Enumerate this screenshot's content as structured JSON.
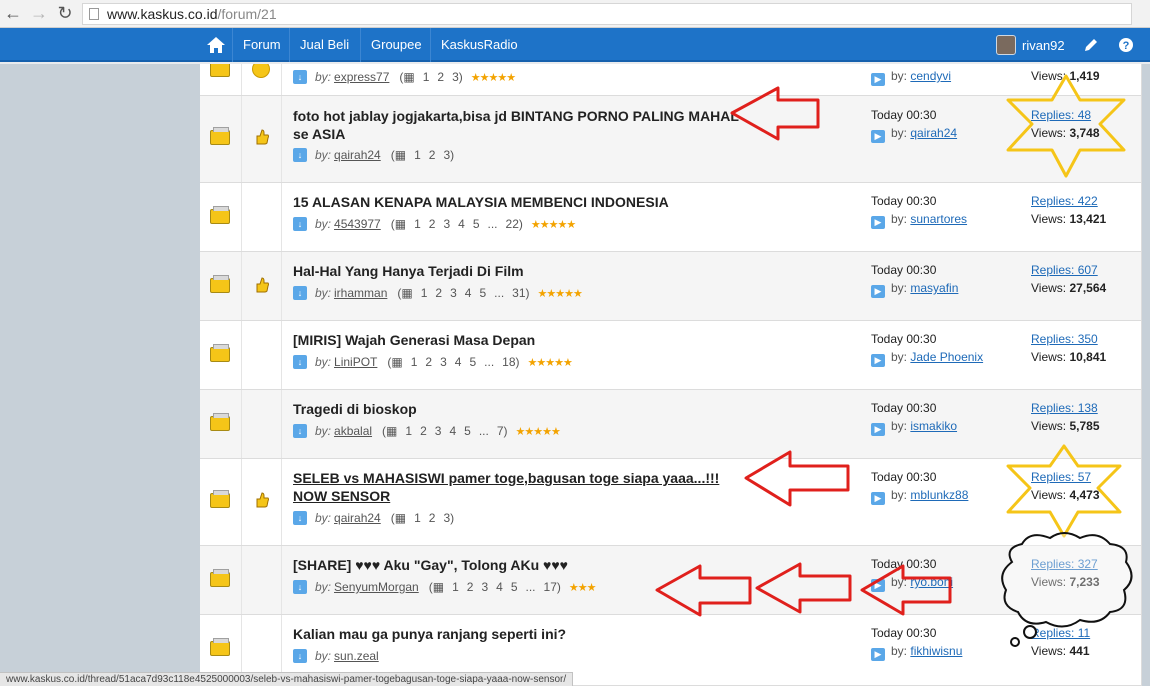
{
  "browser": {
    "url_host": "www.kaskus.co.id",
    "url_path": "/forum/21"
  },
  "nav": {
    "items": [
      "Forum",
      "Jual Beli",
      "Groupee",
      "KaskusRadio"
    ],
    "username": "rivan92"
  },
  "threads": [
    {
      "title": "",
      "author": "express77",
      "pages": [
        "1",
        "2",
        "3"
      ],
      "last_time": "",
      "last_user": "cendyvi",
      "replies": "",
      "views_label": "Views:",
      "views": "1,419"
    },
    {
      "title": "foto hot jablay jogjakarta,bisa jd BINTANG PORNO PALING MAHAL se ASIA",
      "author": "qairah24",
      "pages": [
        "1",
        "2",
        "3"
      ],
      "last_time": "Today 00:30",
      "last_user": "qairah24",
      "replies": "Replies: 48",
      "views_label": "Views:",
      "views": "3,748"
    },
    {
      "title": "15 ALASAN KENAPA MALAYSIA MEMBENCI INDONESIA",
      "author": "4543977",
      "pages": [
        "1",
        "2",
        "3",
        "4",
        "5",
        "...",
        "22"
      ],
      "last_time": "Today 00:30",
      "last_user": "sunartores",
      "replies": "Replies: 422",
      "views_label": "Views:",
      "views": "13,421"
    },
    {
      "title": "Hal-Hal Yang Hanya Terjadi Di Film",
      "author": "irhamman",
      "pages": [
        "1",
        "2",
        "3",
        "4",
        "5",
        "...",
        "31"
      ],
      "last_time": "Today 00:30",
      "last_user": "masyafin",
      "replies": "Replies: 607",
      "views_label": "Views:",
      "views": "27,564"
    },
    {
      "title": "[MIRIS] Wajah Generasi Masa Depan",
      "author": "LiniPOT",
      "pages": [
        "1",
        "2",
        "3",
        "4",
        "5",
        "...",
        "18"
      ],
      "last_time": "Today 00:30",
      "last_user": "Jade Phoenix",
      "replies": "Replies: 350",
      "views_label": "Views:",
      "views": "10,841"
    },
    {
      "title": "Tragedi di bioskop",
      "author": "akbalal",
      "pages": [
        "1",
        "2",
        "3",
        "4",
        "5",
        "...",
        "7"
      ],
      "last_time": "Today 00:30",
      "last_user": "ismakiko",
      "replies": "Replies: 138",
      "views_label": "Views:",
      "views": "5,785"
    },
    {
      "title": "SELEB vs MAHASISWI pamer toge,bagusan toge siapa yaaa...!!! NOW SENSOR",
      "author": "qairah24",
      "pages": [
        "1",
        "2",
        "3"
      ],
      "last_time": "Today 00:30",
      "last_user": "mblunkz88",
      "replies": "Replies: 57",
      "views_label": "Views:",
      "views": "4,473"
    },
    {
      "title": "[SHARE] ♥♥♥ Aku \"Gay\", Tolong AKu ♥♥♥",
      "author": "SenyumMorgan",
      "pages": [
        "1",
        "2",
        "3",
        "4",
        "5",
        "...",
        "17"
      ],
      "last_time": "Today 00:30",
      "last_user": "ryo.boni",
      "replies": "Replies: 327",
      "views_label": "Views:",
      "views": "7,233"
    },
    {
      "title": "Kalian mau ga punya ranjang seperti ini?",
      "author": "sun.zeal",
      "pages": [],
      "last_time": "Today 00:30",
      "last_user": "fikhiwisnu",
      "replies": "Replies: 11",
      "views_label": "Views:",
      "views": "441"
    }
  ],
  "labels": {
    "by": "by:"
  },
  "status_url": "www.kaskus.co.id/thread/51aca7d93c118e4525000003/seleb-vs-mahasiswi-pamer-togebagusan-toge-siapa-yaaa-now-sensor/",
  "colors": {
    "nav_blue": "#1e73c8",
    "annotation_red": "#e0201c",
    "annotation_yellow": "#f5c518"
  }
}
